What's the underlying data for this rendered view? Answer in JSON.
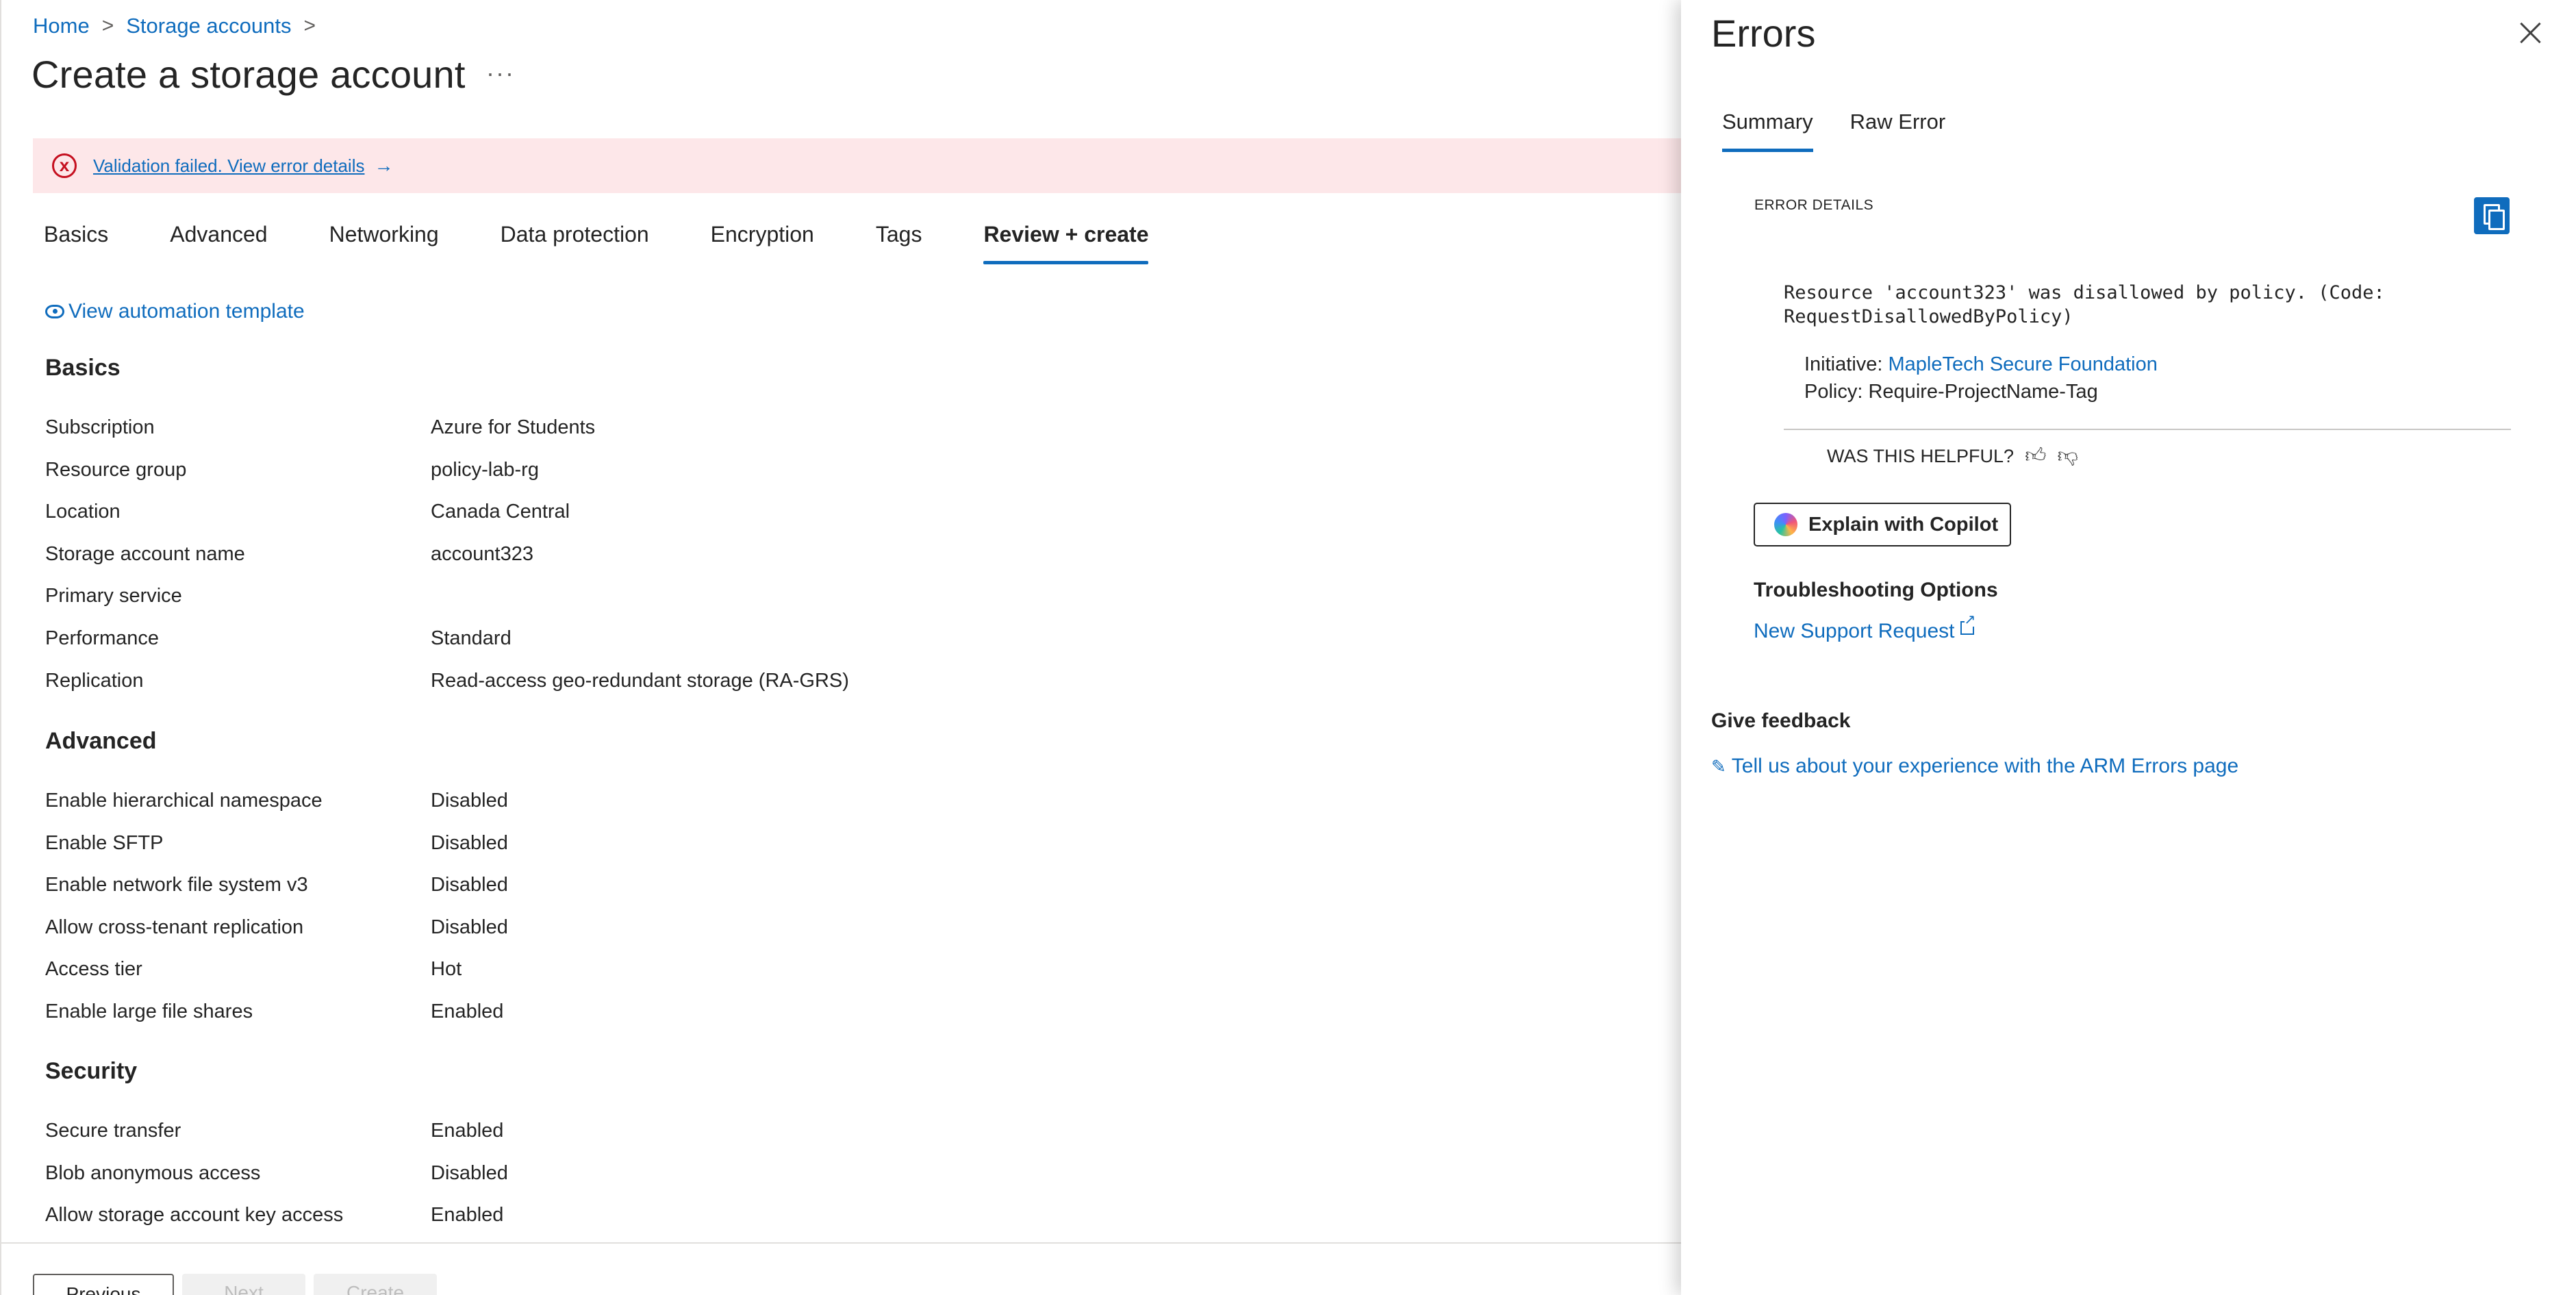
{
  "breadcrumb": {
    "home": "Home",
    "storage_accounts": "Storage accounts",
    "sep": ">"
  },
  "page": {
    "title": "Create a storage account",
    "more": "···"
  },
  "error_banner": {
    "text": "Validation failed. View error details",
    "arrow": "→",
    "icon": "x"
  },
  "tabs": [
    "Basics",
    "Advanced",
    "Networking",
    "Data protection",
    "Encryption",
    "Tags",
    "Review + create"
  ],
  "active_tab": "Review + create",
  "automation_link": "View automation template",
  "sections": {
    "basics": {
      "title": "Basics",
      "rows": [
        {
          "label": "Subscription",
          "value": "Azure for Students"
        },
        {
          "label": "Resource group",
          "value": "policy-lab-rg"
        },
        {
          "label": "Location",
          "value": "Canada Central"
        },
        {
          "label": "Storage account name",
          "value": "account323"
        },
        {
          "label": "Primary service",
          "value": ""
        },
        {
          "label": "Performance",
          "value": "Standard"
        },
        {
          "label": "Replication",
          "value": "Read-access geo-redundant storage (RA-GRS)"
        }
      ]
    },
    "advanced": {
      "title": "Advanced",
      "rows": [
        {
          "label": "Enable hierarchical namespace",
          "value": "Disabled"
        },
        {
          "label": "Enable SFTP",
          "value": "Disabled"
        },
        {
          "label": "Enable network file system v3",
          "value": "Disabled"
        },
        {
          "label": "Allow cross-tenant replication",
          "value": "Disabled"
        },
        {
          "label": "Access tier",
          "value": "Hot"
        },
        {
          "label": "Enable large file shares",
          "value": "Enabled"
        }
      ]
    },
    "security": {
      "title": "Security",
      "rows": [
        {
          "label": "Secure transfer",
          "value": "Enabled"
        },
        {
          "label": "Blob anonymous access",
          "value": "Disabled"
        },
        {
          "label": "Allow storage account key access",
          "value": "Enabled"
        }
      ]
    }
  },
  "footer": {
    "previous": "Previous",
    "next": "Next",
    "create": "Create"
  },
  "errors_panel": {
    "title": "Errors",
    "tabs": [
      "Summary",
      "Raw Error"
    ],
    "details_label": "ERROR DETAILS",
    "message_line1": "Resource 'account323' was disallowed by policy. (Code:",
    "message_line2": "RequestDisallowedByPolicy)",
    "initiative_label": "Initiative:",
    "initiative_value": "MapleTech Secure Foundation",
    "policy_label": "Policy:",
    "policy_value": "Require-ProjectName-Tag",
    "helpful": "WAS THIS HELPFUL?",
    "copilot_button": "Explain with Copilot",
    "troubleshooting_title": "Troubleshooting Options",
    "support_link": "New Support Request",
    "feedback_title": "Give feedback",
    "feedback_link": "Tell us about your experience with the ARM Errors page"
  },
  "colors": {
    "accent": "#0f6cbd",
    "error": "#c50f1f",
    "error_bg": "#fde7e9"
  }
}
